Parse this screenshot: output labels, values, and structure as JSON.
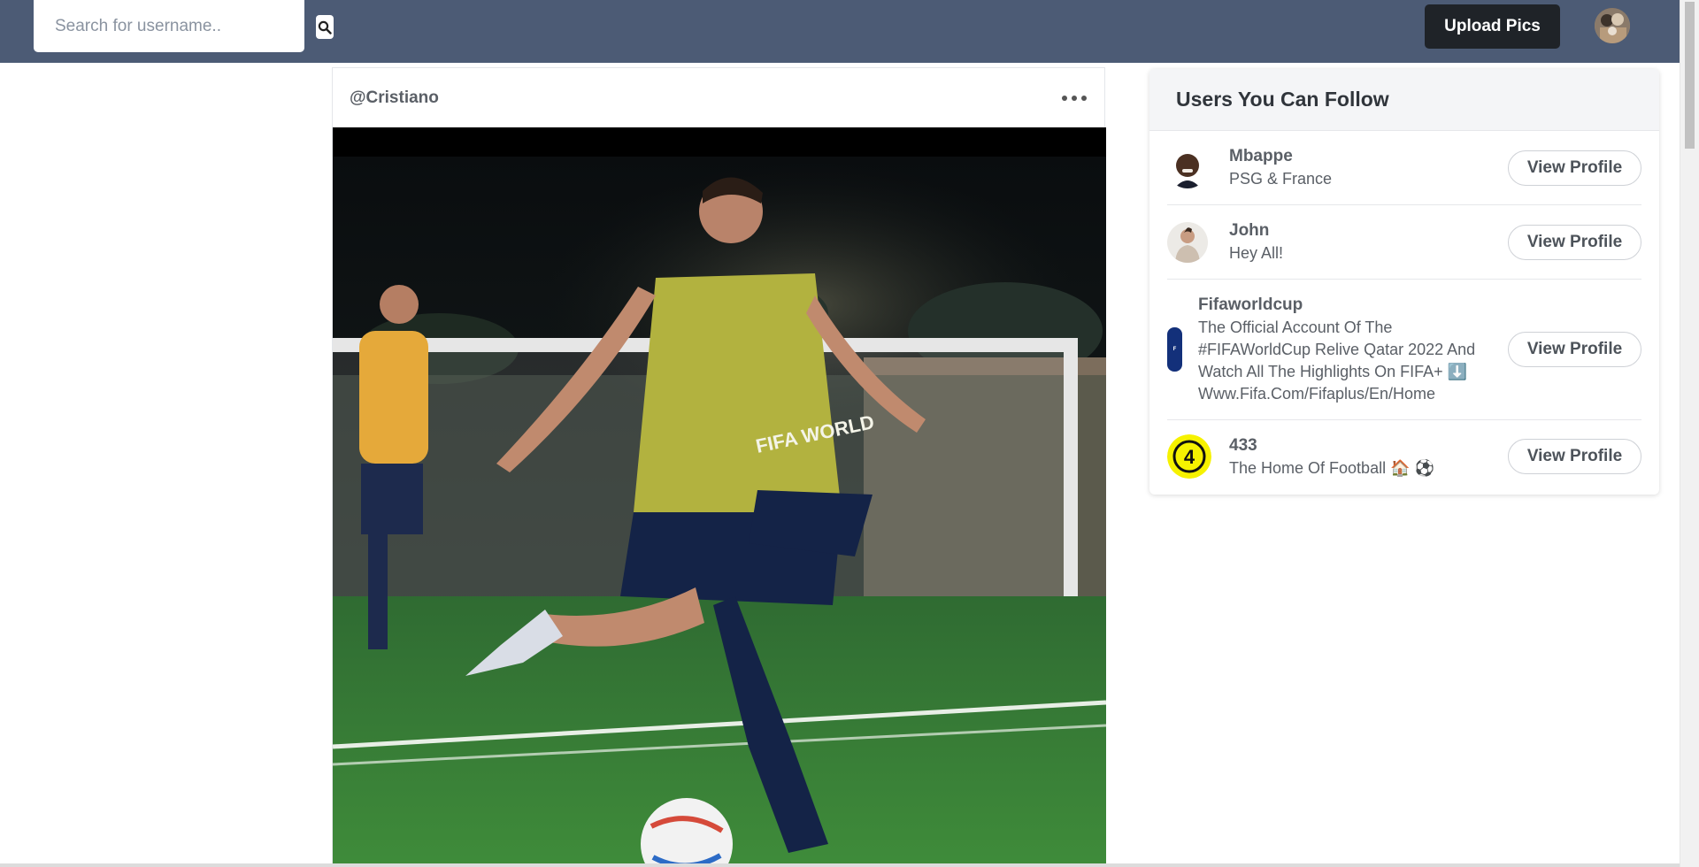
{
  "topnav": {
    "search_placeholder": "Search for username..",
    "search_icon": "magnifier-icon",
    "upload_label": "Upload Pics",
    "avatar_icon": "user-avatar"
  },
  "post": {
    "username": "@Cristiano",
    "more_icon": "more-horizontal-icon",
    "image": "photo of footballer kicking a ball on a training pitch at night"
  },
  "suggestions": {
    "title": "Users You Can Follow",
    "button_label": "View Profile",
    "users": [
      {
        "name": "Mbappe",
        "bio": "PSG & France"
      },
      {
        "name": "John",
        "bio": "Hey All!"
      },
      {
        "name": "Fifaworldcup",
        "bio": "The Official Account Of The #FIFAWorldCup Relive Qatar 2022 And Watch All The Highlights On FIFA+ ⬇️ Www.Fifa.Com/Fifaplus/En/Home"
      },
      {
        "name": "433",
        "bio": "The Home Of Football 🏠 ⚽"
      }
    ]
  },
  "colors": {
    "nav_bg": "#4c5b75",
    "upload_bg": "#1f2328",
    "text_muted": "#5a5f66"
  }
}
